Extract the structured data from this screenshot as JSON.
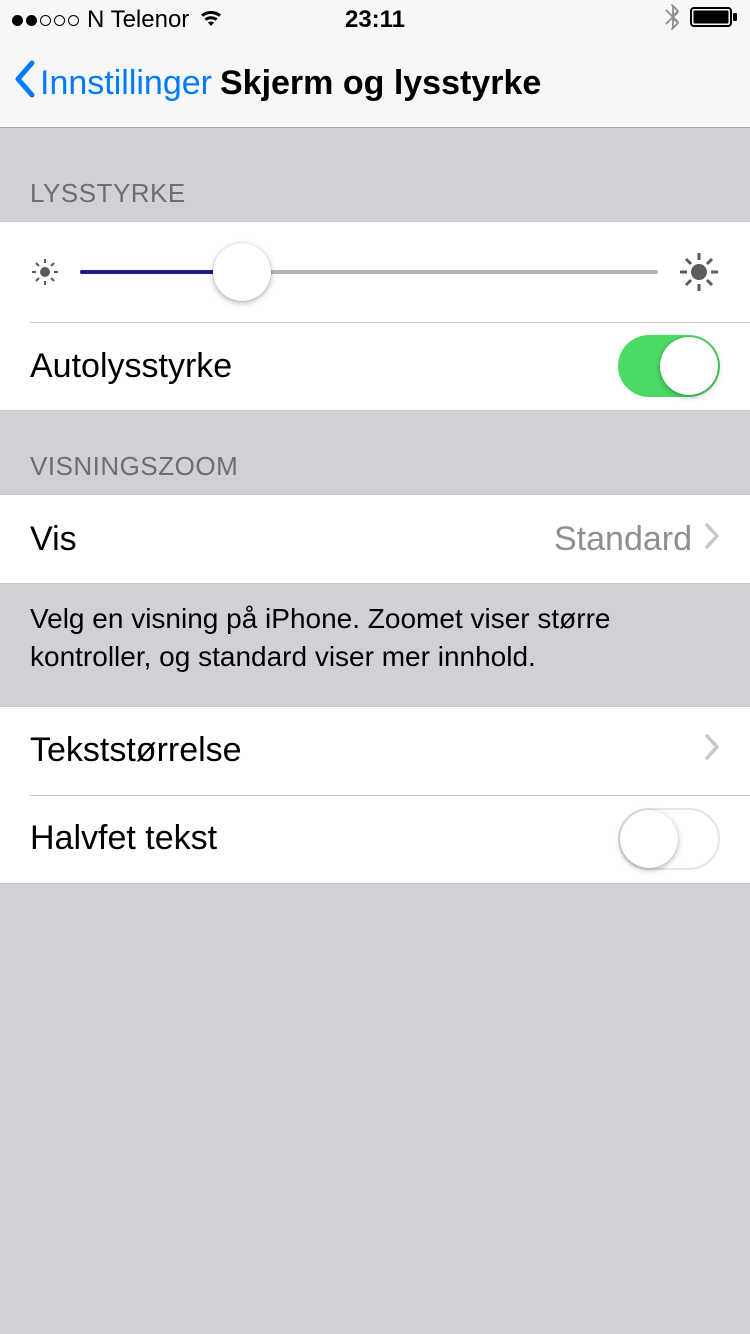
{
  "status_bar": {
    "carrier": "N Telenor",
    "time": "23:11",
    "signal_filled": 2,
    "signal_total": 5
  },
  "nav": {
    "back_label": "Innstillinger",
    "title": "Skjerm og lysstyrke"
  },
  "brightness": {
    "header": "LYSSTYRKE",
    "slider_percent": 28,
    "auto_label": "Autolysstyrke",
    "auto_on": true
  },
  "display_zoom": {
    "header": "VISNINGSZOOM",
    "view_label": "Vis",
    "view_value": "Standard",
    "footer": "Velg en visning på iPhone. Zoomet viser større kontroller, og standard viser mer innhold."
  },
  "text": {
    "text_size_label": "Tekststørrelse",
    "bold_text_label": "Halvfet tekst",
    "bold_text_on": false
  }
}
